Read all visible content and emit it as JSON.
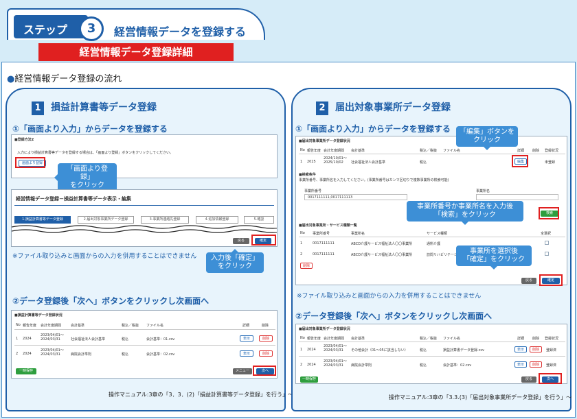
{
  "header": {
    "step_word": "ステップ",
    "step_number": "3",
    "step_title": "経営情報データを登録する",
    "banner": "経営情報データ登録詳細"
  },
  "flow_title": "経営情報データ登録の流れ",
  "left": {
    "num": "1",
    "title": "損益計算書等データ登録",
    "sub1": "①「画面より入力」からデータを登録する",
    "shot1": {
      "title": "■登録方法2",
      "desc": "入力により損益計算書等データを登録する場合は、「画面より登録」ボタンをクリックしてください。",
      "button": "画面より登録"
    },
    "callout1": "「画面より登録」\nをクリック",
    "shot2": {
      "title": "経営情報データ登録－損益計算書等データ表示・編集",
      "steps": [
        "1.損益計算書等データ登録",
        "2.届出対象事業所データ登録",
        "3.事業所連絡先登録",
        "4.追加情報登録",
        "5.確認"
      ],
      "back": "戻る",
      "confirm": "確定"
    },
    "note": "※ファイル取り込みと画面からの入力を併用することはできません",
    "callout2": "入力後「確定」\nをクリック",
    "sub2": "②データ登録後「次へ」ボタンをクリックし次画面へ",
    "shot3": {
      "title": "■損益計算書等データ登録状況",
      "cols": [
        "No",
        "報告年度",
        "会計年度期間",
        "会計基準",
        "税込／税抜",
        "ファイル名",
        "詳細",
        "削除"
      ],
      "rows": [
        [
          "1",
          "2024",
          "2023/04/01～\n2024/03/31",
          "社会福祉法人会計基準",
          "税込",
          "会計基準：01.csv",
          "表示",
          "削除"
        ],
        [
          "2",
          "2024",
          "2023/04/01～\n2024/03/31",
          "病院会計準則",
          "税込",
          "会計基準：02.csv",
          "表示",
          "削除"
        ]
      ],
      "save": "一時保存",
      "menu": "メニュー",
      "next": "次へ"
    },
    "ref": "操作マニュアル:3章の「3．3．(2)「損益計算書等データ登録」を行う」～"
  },
  "right": {
    "num": "2",
    "title": "届出対象事業所データ登録",
    "sub1": "①「画面より入力」からデータを登録する",
    "callout_edit": "「編集」ボタンを\nクリック",
    "shot1": {
      "title": "■届出対象事業所データ登録状況",
      "cols": [
        "No",
        "報告年度",
        "会計年度期間",
        "会計基準",
        "税込／税抜",
        "ファイル名",
        "詳細",
        "削除",
        "登録状況"
      ],
      "row": [
        "1",
        "2025",
        "2024/10/01～\n2025/10/02",
        "社会福祉法人会計基準",
        "税込",
        "",
        "編集",
        "",
        "未登録"
      ],
      "search_title": "■検索条件",
      "search_desc": "事業所番号、事業所名を入力してください。(事業所番号はカンマ区切りで複数事業所の検索可能)",
      "f1": "事業所番号",
      "f2": "事業所名",
      "f1val": "0017111111,0017111113",
      "search": "検索",
      "list_title": "■届出対象事業所・サービス種類一覧",
      "cols2": [
        "No",
        "事業所番号",
        "事業所名",
        "サービス種類",
        "全選択"
      ],
      "rows2": [
        [
          "1",
          "0017111111",
          "ABCD介護サービス福祉法人〇〇事業所",
          "通所介護"
        ],
        [
          "2",
          "0017111111",
          "ABCD介護サービス福祉法人〇〇事業所",
          "訪問リハビリテーション"
        ]
      ],
      "delete": "削除",
      "back": "戻る",
      "confirm": "確定"
    },
    "callout_search": "事業所番号か事業所名を入力後\n「検索」をクリック",
    "callout_select": "事業所を選択後\n「確定」をクリック",
    "note": "※ファイル取り込みと画面からの入力を併用することはできません",
    "sub2": "②データ登録後「次へ」ボタンをクリックし次画面へ",
    "shot2": {
      "title": "■届出対象事業所データ登録状況",
      "cols": [
        "No",
        "報告年度",
        "会計年度期間",
        "会計基準",
        "税込／税抜",
        "ファイル名",
        "詳細",
        "削除",
        "登録状況"
      ],
      "rows": [
        [
          "1",
          "2024",
          "2023/04/01～\n2024/03/31",
          "その他会計（01～05に該当しない）",
          "税込",
          "損益計算書データ登録.csv",
          "表示",
          "削除",
          "登録済"
        ],
        [
          "2",
          "2024",
          "2023/04/01～\n2024/03/31",
          "病院会計準則",
          "税込",
          "会計基準：02.csv",
          "表示",
          "削除",
          "登録済"
        ]
      ],
      "save": "一時保存",
      "back": "戻る",
      "next": "次へ"
    },
    "ref": "操作マニュアル:3章の「3.3.(3)「届出対象事業所データ登録」を行う」～"
  }
}
